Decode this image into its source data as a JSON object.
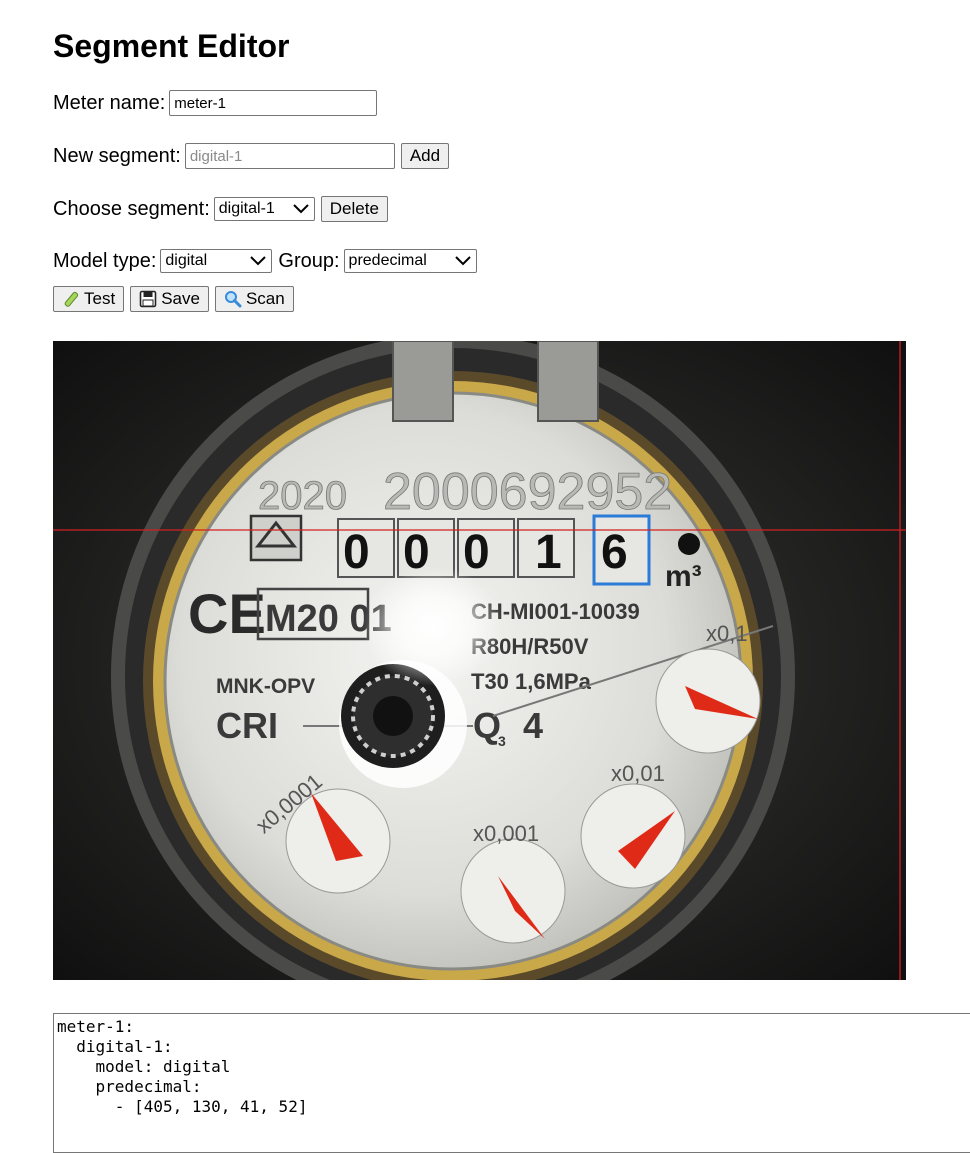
{
  "page": {
    "title": "Segment Editor"
  },
  "meter": {
    "label": "Meter name:",
    "value": "meter-1"
  },
  "new_segment": {
    "label": "New segment:",
    "placeholder": "digital-1",
    "add_label": "Add"
  },
  "choose_segment": {
    "label": "Choose segment:",
    "selected": "digital-1",
    "delete_label": "Delete"
  },
  "model": {
    "label": "Model type:",
    "selected": "digital",
    "group_label": "Group:",
    "group_selected": "predecimal"
  },
  "actions": {
    "test_label": "Test",
    "test_icon": "test-tube-icon",
    "save_label": "Save",
    "save_icon": "floppy-disk-icon",
    "scan_label": "Scan",
    "scan_icon": "magnifier-icon"
  },
  "meter_image": {
    "serial_year": "2020",
    "serial_number": "2000692952",
    "digits": [
      "0",
      "0",
      "0",
      "1",
      "6"
    ],
    "unit": "m³",
    "ce_mark": "CE",
    "ce_code": "M20 01",
    "model_code": "CH-MI001-10039",
    "ratio": "R80H/R50V",
    "temp_pressure": "T30  1,6MPa",
    "brand": "MNK-OPV",
    "brand2": "CRI",
    "q3_value": "4",
    "dials": [
      {
        "multiplier": "x0,1"
      },
      {
        "multiplier": "x0,01"
      },
      {
        "multiplier": "x0,001"
      },
      {
        "multiplier": "x0,0001"
      }
    ],
    "crosshair_color": "#d42020",
    "selection_color": "#2b7bd8",
    "needle_color": "#e02a18"
  },
  "yaml_output": "meter-1:\n  digital-1:\n    model: digital\n    predecimal:\n      - [405, 130, 41, 52]"
}
